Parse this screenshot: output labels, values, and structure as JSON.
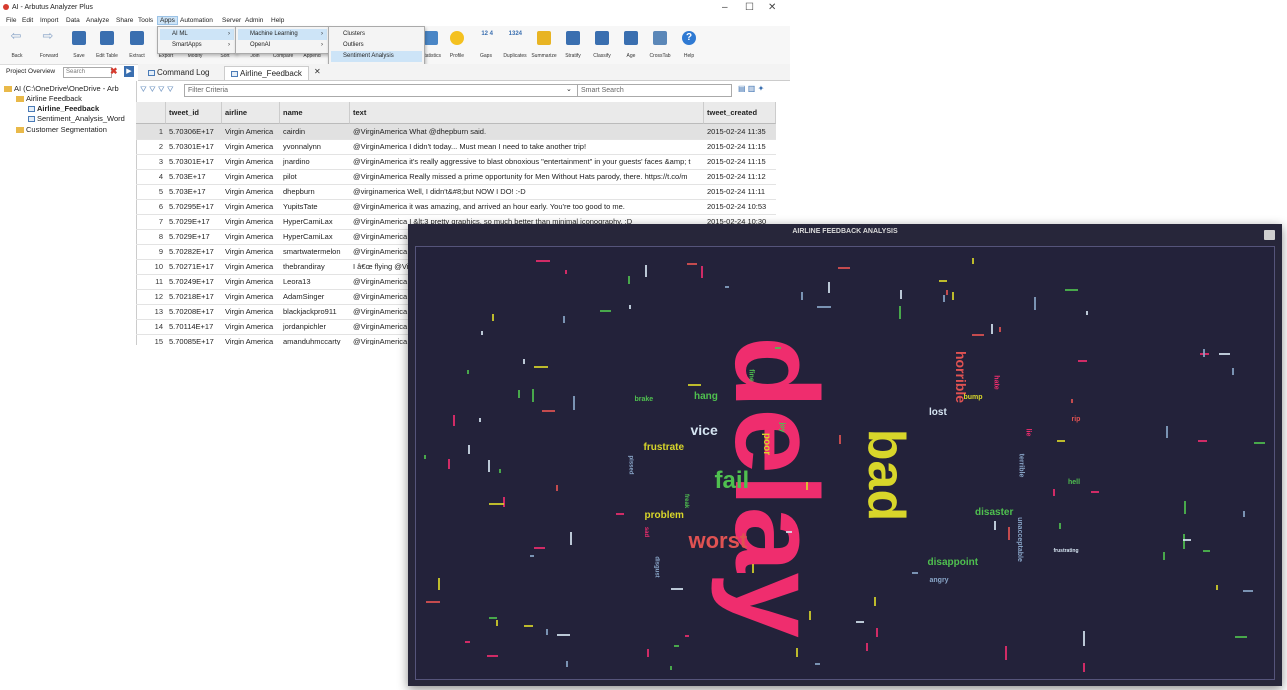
{
  "window": {
    "title": "AI - Arbutus Analyzer Plus",
    "controls": [
      "–",
      "☐",
      "✕"
    ]
  },
  "menubar": [
    "File",
    "Edit",
    "Import",
    "Data",
    "Analyze",
    "Share",
    "Tools",
    "Apps",
    "Automation",
    "Server",
    "Admin",
    "Help"
  ],
  "toolbar": [
    "Back",
    "Forward",
    "Save",
    "Edit Table",
    "Extract",
    "Export",
    "Modify",
    "Sort",
    "Join",
    "Compare",
    "Append",
    "Statistics",
    "Profile",
    "Gaps",
    "Duplicates",
    "Summarize",
    "Stratify",
    "Classify",
    "Age",
    "CrossTab",
    "Help"
  ],
  "toolbar_counts": {
    "gaps": "12 4",
    "duplicates": "1324"
  },
  "apps_menu": [
    "AI ML",
    "SmartApps"
  ],
  "ai_menu": [
    "Machine Learning",
    "OpenAI"
  ],
  "ml_menu": [
    "Clusters",
    "Outliers",
    "Sentiment Analysis"
  ],
  "tabs": {
    "tab1": "Command Log",
    "tab2": "Airline_Feedback"
  },
  "project": {
    "label": "Project Overview",
    "search_placeholder": "Search"
  },
  "tree": {
    "root": "AI (C:\\OneDrive\\OneDrive - Arb",
    "folder1": "Airline Feedback",
    "table1": "Airline_Feedback",
    "table2": "Sentiment_Analysis_Word",
    "folder2": "Customer Segmentation"
  },
  "filter": {
    "placeholder": "Filter Criteria",
    "smart_placeholder": "Smart Search"
  },
  "table": {
    "columns": [
      "tweet_id",
      "airline",
      "name",
      "text",
      "tweet_created"
    ],
    "rows": [
      [
        "1",
        "5.70306E+17",
        "Virgin America",
        "cairdin",
        "@VirginAmerica What @dhepburn said.",
        "2015-02-24 11:35"
      ],
      [
        "2",
        "5.70301E+17",
        "Virgin America",
        "yvonnalynn",
        "@VirginAmerica I didn't today... Must mean I need to take another trip!",
        "2015-02-24 11:15"
      ],
      [
        "3",
        "5.70301E+17",
        "Virgin America",
        "jnardino",
        "@VirginAmerica it's really aggressive to blast obnoxious \"entertainment\" in your guests' faces &amp; t",
        "2015-02-24 11:15"
      ],
      [
        "4",
        "5.703E+17",
        "Virgin America",
        "pilot",
        "@VirginAmerica Really missed a prime opportunity for Men Without Hats parody, there. https://t.co/m",
        "2015-02-24 11:12"
      ],
      [
        "5",
        "5.703E+17",
        "Virgin America",
        "dhepburn",
        "@virginamerica Well, I didn't&#8;but NOW I DO! :-D",
        "2015-02-24 11:11"
      ],
      [
        "6",
        "5.70295E+17",
        "Virgin America",
        "YupitsTate",
        "@VirginAmerica it was amazing, and arrived an hour early. You're too good to me.",
        "2015-02-24 10:53"
      ],
      [
        "7",
        "5.7029E+17",
        "Virgin America",
        "HyperCamiLax",
        "@VirginAmerica I &lt;3 pretty graphics. so much better than minimal iconography. :D",
        "2015-02-24 10:30"
      ],
      [
        "8",
        "5.7029E+17",
        "Virgin America",
        "HyperCamiLax",
        "@VirginAmerica",
        ""
      ],
      [
        "9",
        "5.70282E+17",
        "Virgin America",
        "smartwatermelon",
        "@VirginAmerica",
        ""
      ],
      [
        "10",
        "5.70271E+17",
        "Virgin America",
        "thebrandiray",
        "I â€œ flying @Vi",
        ""
      ],
      [
        "11",
        "5.70249E+17",
        "Virgin America",
        "Leora13",
        "@VirginAmerica",
        ""
      ],
      [
        "12",
        "5.70218E+17",
        "Virgin America",
        "AdamSinger",
        "@VirginAmerica",
        ""
      ],
      [
        "13",
        "5.70208E+17",
        "Virgin America",
        "blackjackpro911",
        "@VirginAmerica",
        ""
      ],
      [
        "14",
        "5.70114E+17",
        "Virgin America",
        "jordanpichler",
        "@VirginAmerica",
        ""
      ],
      [
        "15",
        "5.70085E+17",
        "Virgin America",
        "amanduhmccarty",
        "@VirginAmerica",
        ""
      ]
    ]
  },
  "wordcloud": {
    "title": "AIRLINE FEEDBACK ANALYSIS",
    "words": [
      {
        "text": "delay",
        "color": "#ef2d6e"
      },
      {
        "text": "bad",
        "color": "#d8d62a"
      },
      {
        "text": "fail",
        "color": "#4fc04f"
      },
      {
        "text": "worst",
        "color": "#e05252"
      },
      {
        "text": "horrible",
        "color": "#e05252"
      },
      {
        "text": "vice",
        "color": "#d6e5f2"
      },
      {
        "text": "frustrate",
        "color": "#d8d62a"
      },
      {
        "text": "hang",
        "color": "#4fc04f"
      },
      {
        "text": "problem",
        "color": "#d8d62a"
      },
      {
        "text": "disaster",
        "color": "#4fc04f"
      },
      {
        "text": "disappoint",
        "color": "#4fc04f"
      },
      {
        "text": "lost",
        "color": "#d6e5f2"
      },
      {
        "text": "bump",
        "color": "#d8d62a"
      },
      {
        "text": "brake",
        "color": "#4fc04f"
      },
      {
        "text": "poor",
        "color": "#d8d62a"
      },
      {
        "text": "angry",
        "color": "#8aa7c9"
      },
      {
        "text": "hell",
        "color": "#4fc04f"
      },
      {
        "text": "rip",
        "color": "#e05252"
      },
      {
        "text": "terrible",
        "color": "#8aa7c9"
      },
      {
        "text": "unacceptable",
        "color": "#8aa7c9"
      },
      {
        "text": "hate",
        "color": "#ef2d6e"
      },
      {
        "text": "lie",
        "color": "#ef2d6e"
      },
      {
        "text": "pissed",
        "color": "#8aa7c9"
      },
      {
        "text": "disgust",
        "color": "#8aa7c9"
      },
      {
        "text": "fine",
        "color": "#4fc04f"
      },
      {
        "text": "joy",
        "color": "#4fc04f"
      },
      {
        "text": "freak",
        "color": "#4fc04f"
      },
      {
        "text": "sad",
        "color": "#ef2d6e"
      },
      {
        "text": "frustrating",
        "color": "#d6e5f2"
      }
    ],
    "tick_colors": [
      "#ef2d6e",
      "#d8d62a",
      "#4fc04f",
      "#8aa7c9",
      "#d6e5f2",
      "#e05252"
    ]
  }
}
